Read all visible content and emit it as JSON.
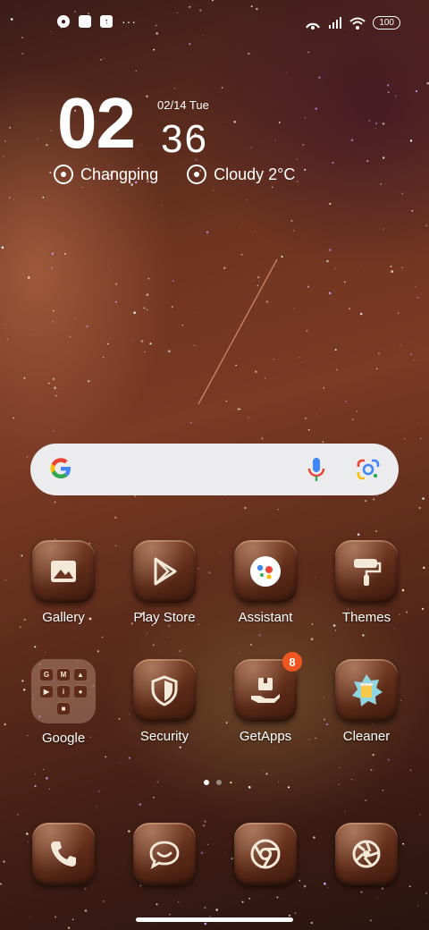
{
  "status_bar": {
    "left_icons": [
      "app-notification-icon",
      "square-notification-icon",
      "upload-notification-icon"
    ],
    "more": "···",
    "battery": "100"
  },
  "clock": {
    "hours": "02",
    "minutes": "36",
    "date": "02/14 Tue"
  },
  "weather": {
    "location": "Changping",
    "condition": "Cloudy 2°C"
  },
  "search_bar": {
    "logo": "G"
  },
  "apps_row1": [
    {
      "label": "Gallery",
      "icon": "gallery-icon"
    },
    {
      "label": "Play Store",
      "icon": "play-store-icon"
    },
    {
      "label": "Assistant",
      "icon": "assistant-icon"
    },
    {
      "label": "Themes",
      "icon": "themes-icon"
    }
  ],
  "apps_row2": [
    {
      "label": "Google",
      "icon": "folder"
    },
    {
      "label": "Security",
      "icon": "shield-icon"
    },
    {
      "label": "GetApps",
      "icon": "getapps-icon",
      "badge": "8"
    },
    {
      "label": "Cleaner",
      "icon": "cleaner-icon"
    }
  ],
  "folder_minis": [
    "G",
    "M",
    "▲",
    "▶",
    "i",
    "●",
    "■"
  ],
  "dock": [
    {
      "icon": "phone-icon"
    },
    {
      "icon": "messages-icon"
    },
    {
      "icon": "chrome-icon"
    },
    {
      "icon": "camera-icon"
    }
  ],
  "pager": {
    "pages": 2,
    "current": 1
  },
  "colors": {
    "badge": "#f0561f",
    "tile": "#5e2b18",
    "search_bg": "#ececee"
  }
}
